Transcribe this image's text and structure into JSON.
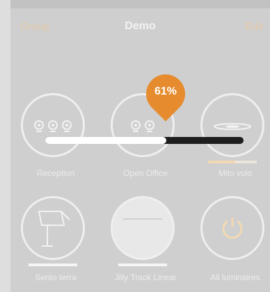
{
  "header": {
    "left": "Group",
    "title": "Demo",
    "right": "Edit"
  },
  "slider": {
    "value_label": "61%",
    "level": 0.61
  },
  "tiles": [
    {
      "label": "Reception",
      "icon": "three-lamps-icon"
    },
    {
      "label": "Open Office",
      "icon": "two-lamps-icon"
    },
    {
      "label": "Mito volo",
      "icon": "pendant-lamp-icon",
      "bar_level": 0.55
    },
    {
      "label": "Sento terra",
      "icon": "floor-lamp-icon",
      "bar_level": 0.6
    },
    {
      "label": "Jilly Track Linear",
      "icon": "linear-light-icon",
      "bar_level": 0.6
    },
    {
      "label": "All luminaires",
      "icon": "power-icon"
    }
  ],
  "colors": {
    "accent": "#e68c2f",
    "background": "#cfcfcf"
  }
}
